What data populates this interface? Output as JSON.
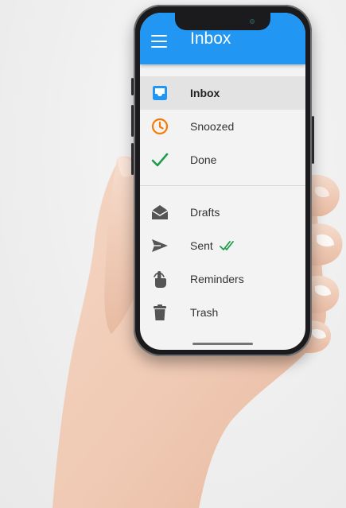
{
  "app": {
    "title": "Inbox",
    "accent_color": "#2196f3"
  },
  "menu": {
    "primary": [
      {
        "label": "Inbox",
        "icon": "inbox-icon",
        "selected": true
      },
      {
        "label": "Snoozed",
        "icon": "clock-icon"
      },
      {
        "label": "Done",
        "icon": "check-icon"
      }
    ],
    "secondary": [
      {
        "label": "Drafts",
        "icon": "envelope-open-icon"
      },
      {
        "label": "Sent",
        "icon": "send-icon",
        "badge_icon": "double-check-icon"
      },
      {
        "label": "Reminders",
        "icon": "finger-ribbon-icon"
      },
      {
        "label": "Trash",
        "icon": "trash-icon"
      }
    ]
  }
}
